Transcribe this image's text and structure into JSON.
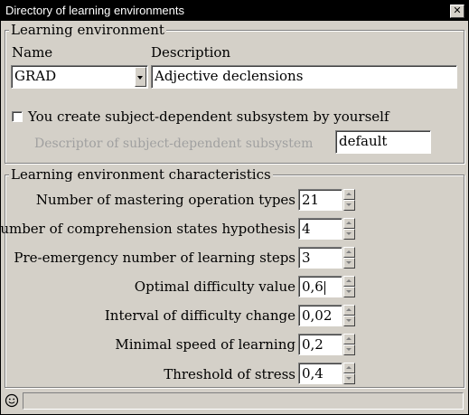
{
  "window": {
    "title": "Directory of learning environments",
    "close_glyph": "✕"
  },
  "env_group": {
    "legend": "Learning environment",
    "name_label": "Name",
    "description_label": "Description",
    "name_value": "GRAD",
    "description_value": "Adjective declensions",
    "checkbox_label": "You create subject-dependent subsystem by yourself",
    "checkbox_checked": false,
    "descriptor_label": "Descriptor of subject-dependent subsystem",
    "descriptor_value": "default"
  },
  "char_group": {
    "legend": "Learning environment characteristics",
    "fields": [
      {
        "label": "Number of mastering operation types",
        "value": "21"
      },
      {
        "label": "Number of comprehension states hypothesis",
        "value": "4"
      },
      {
        "label": "Pre-emergency number of learning steps",
        "value": "3"
      },
      {
        "label": "Optimal difficulty value",
        "value": "0,6"
      },
      {
        "label": "Interval of difficulty change",
        "value": "0,02"
      },
      {
        "label": "Minimal speed of learning",
        "value": "0,2"
      },
      {
        "label": "Threshold of stress",
        "value": "0,4"
      }
    ]
  },
  "status": {
    "icon": "smiley-icon",
    "text": ""
  }
}
